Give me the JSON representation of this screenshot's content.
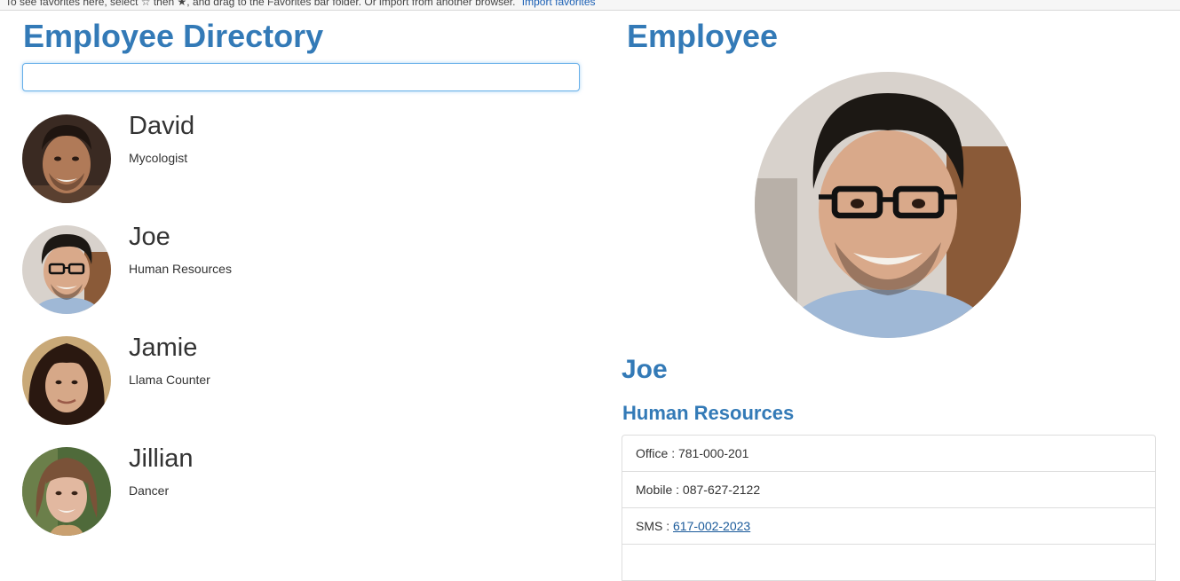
{
  "favorites_bar": {
    "text": "To see favorites here, select ☆ then ★, and drag to the Favorites bar folder. Or import from another browser.",
    "link": "Import favorites"
  },
  "directory": {
    "title": "Employee Directory",
    "search": {
      "value": "",
      "placeholder": ""
    },
    "employees": [
      {
        "name": "David",
        "title": "Mycologist",
        "avatar": "portrait-david"
      },
      {
        "name": "Joe",
        "title": "Human Resources",
        "avatar": "portrait-joe"
      },
      {
        "name": "Jamie",
        "title": "Llama Counter",
        "avatar": "portrait-jamie"
      },
      {
        "name": "Jillian",
        "title": "Dancer",
        "avatar": "portrait-jillian"
      }
    ]
  },
  "detail": {
    "heading": "Employee",
    "photo": "portrait-joe",
    "name": "Joe",
    "department": "Human Resources",
    "contacts": [
      {
        "label": "Office",
        "value": "781-000-201"
      },
      {
        "label": "Mobile",
        "value": "087-627-2122"
      },
      {
        "label": "SMS",
        "value": "617-002-2023"
      }
    ]
  },
  "colors": {
    "heading": "#337ab7",
    "text": "#333333",
    "link": "#1a5a9a",
    "border": "#dddddd",
    "focus": "#66afe9"
  }
}
